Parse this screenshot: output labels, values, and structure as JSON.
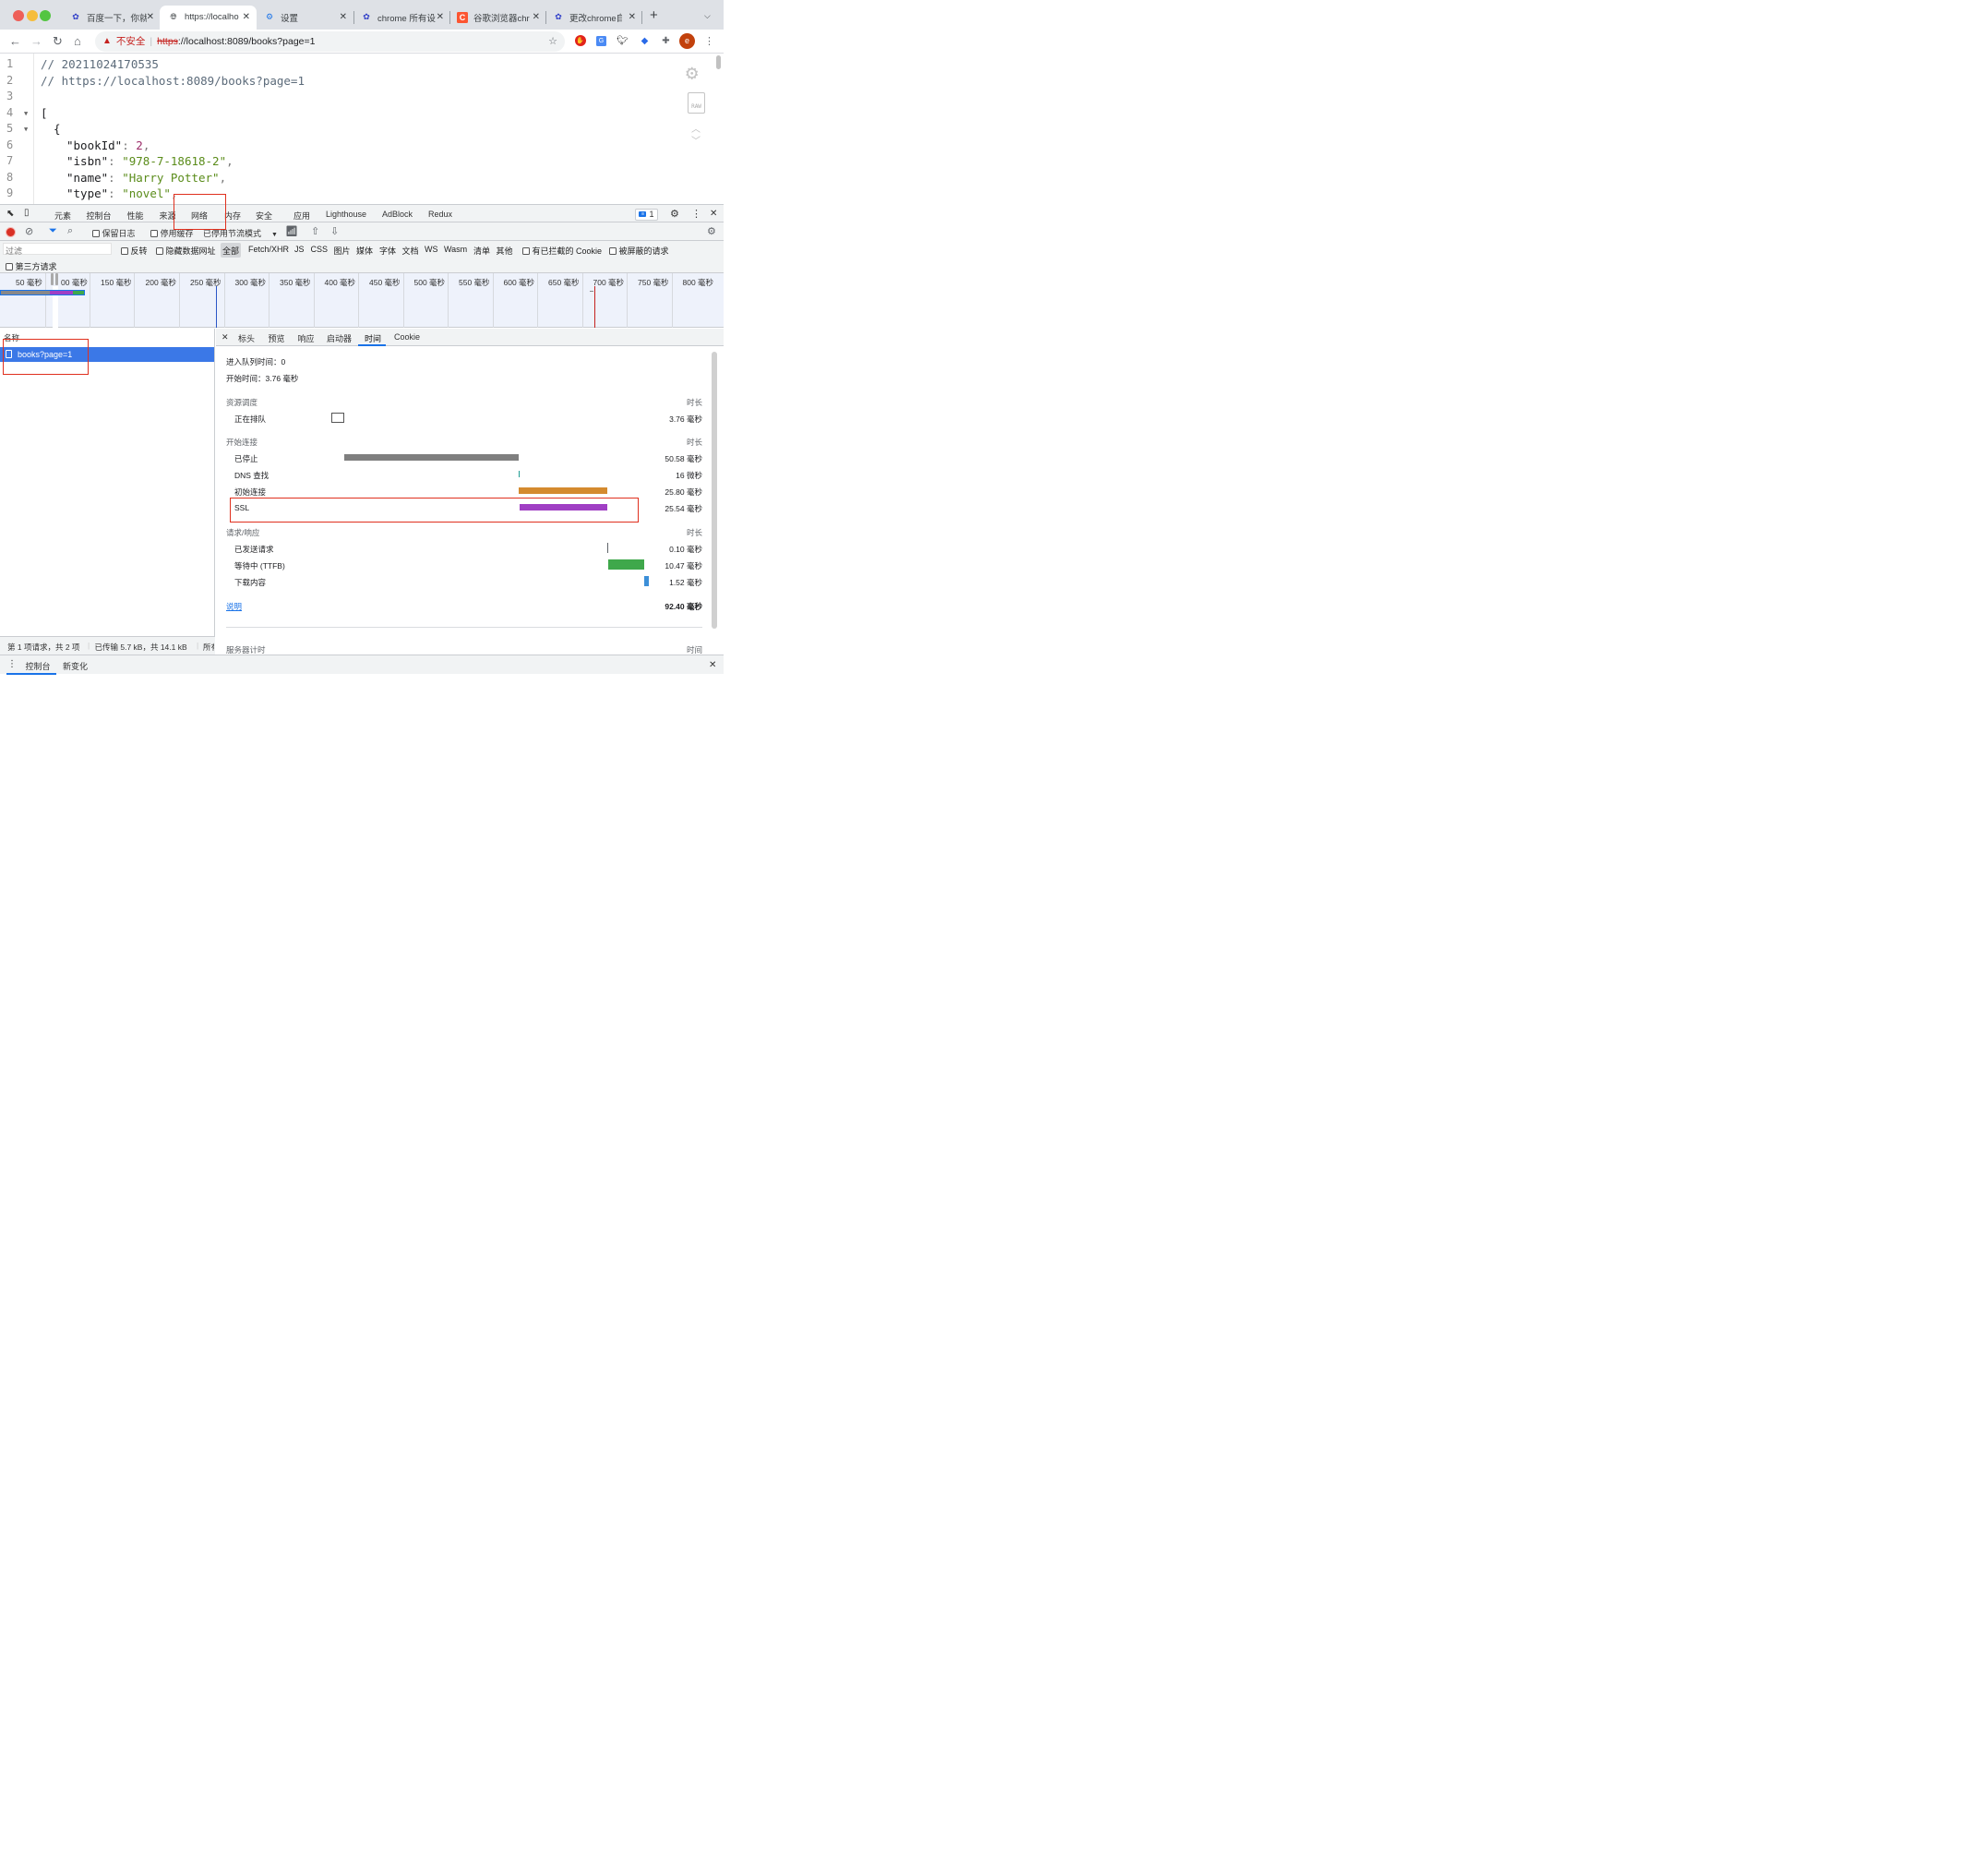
{
  "browser": {
    "tabs": [
      {
        "title": "百度一下，你就",
        "icon": "baidu-paw-icon"
      },
      {
        "title": "https://localho",
        "icon": "globe-icon"
      },
      {
        "title": "设置",
        "icon": "settings-gear-icon"
      },
      {
        "title": "chrome 所有设",
        "icon": "baidu-paw-icon"
      },
      {
        "title": "谷歌浏览器chr",
        "icon": "csdn-c-icon"
      },
      {
        "title": "更改chrome自",
        "icon": "baidu-paw-icon"
      }
    ],
    "new_tab": "+",
    "address": {
      "security_label": "不安全",
      "scheme": "https",
      "rest": "://localhost:8089/books?page=1"
    },
    "profile_letter": "e"
  },
  "code": {
    "lines": [
      {
        "n": "1",
        "text": "// 20211024170535"
      },
      {
        "n": "2",
        "text": "// https://localhost:8089/books?page=1"
      },
      {
        "n": "3",
        "text": ""
      },
      {
        "n": "4",
        "text": "["
      },
      {
        "n": "5",
        "text": "{"
      },
      {
        "n": "6",
        "key": "\"bookId\"",
        "val": "2"
      },
      {
        "n": "7",
        "key": "\"isbn\"",
        "val": "\"978-7-18618-2\""
      },
      {
        "n": "8",
        "key": "\"name\"",
        "val": "\"Harry Potter\""
      },
      {
        "n": "9",
        "key": "\"type\"",
        "val": "\"novel\""
      }
    ],
    "raw_label": "RAW"
  },
  "devtools": {
    "tabs": [
      "元素",
      "控制台",
      "性能",
      "来源",
      "网络",
      "内存",
      "安全",
      "应用",
      "Lighthouse",
      "AdBlock",
      "Redux"
    ],
    "active_tab": "网络",
    "issues_count": "1",
    "network_toolbar": {
      "preserve_log": "保留日志",
      "disable_cache": "停用缓存",
      "throttle": "已停用节流模式"
    },
    "filter": {
      "placeholder": "过滤",
      "invert": "反转",
      "hide_data_urls": "隐藏数据网址",
      "types": [
        "全部",
        "Fetch/XHR",
        "JS",
        "CSS",
        "图片",
        "媒体",
        "字体",
        "文档",
        "WS",
        "Wasm",
        "清单",
        "其他"
      ],
      "blocked_cookies": "有已拦截的 Cookie",
      "blocked_requests": "被屏蔽的请求",
      "third_party": "第三方请求"
    },
    "overview_ticks": [
      "50 毫秒",
      "00 毫秒",
      "150 毫秒",
      "200 毫秒",
      "250 毫秒",
      "300 毫秒",
      "350 毫秒",
      "400 毫秒",
      "450 毫秒",
      "500 毫秒",
      "550 毫秒",
      "600 毫秒",
      "650 毫秒",
      "700 毫秒",
      "750 毫秒",
      "800 毫秒"
    ],
    "name_header": "名称",
    "request": "books?page=1",
    "detail_tabs": [
      "标头",
      "预览",
      "响应",
      "启动器",
      "时间",
      "Cookie"
    ],
    "active_detail_tab": "时间",
    "timing": {
      "queued_at": "进入队列时间：0",
      "started_at": "开始时间：3.76 毫秒",
      "duration_header": "时长",
      "sections": [
        {
          "title": "资源调度",
          "rows": [
            {
              "label": "正在排队",
              "value": "3.76 毫秒",
              "start_ms": 0,
              "dur_ms": 3.76,
              "color": "#ffffff"
            }
          ]
        },
        {
          "title": "开始连接",
          "rows": [
            {
              "label": "已停止",
              "value": "50.58 毫秒",
              "start_ms": 3.76,
              "dur_ms": 50.58,
              "color": "#7f7f7f"
            },
            {
              "label": "DNS 查找",
              "value": "16 微秒",
              "start_ms": 54.34,
              "dur_ms": 0.016,
              "color": "#1f9c93"
            },
            {
              "label": "初始连接",
              "value": "25.80 毫秒",
              "start_ms": 54.36,
              "dur_ms": 25.8,
              "color": "#d48a2e"
            },
            {
              "label": "SSL",
              "value": "25.54 毫秒",
              "start_ms": 54.62,
              "dur_ms": 25.54,
              "color": "#a03fc4"
            }
          ]
        },
        {
          "title": "请求/响应",
          "rows": [
            {
              "label": "已发送请求",
              "value": "0.10 毫秒",
              "start_ms": 80.16,
              "dur_ms": 0.1,
              "color": "#5f6368"
            },
            {
              "label": "等待中 (TTFB)",
              "value": "10.47 毫秒",
              "start_ms": 80.26,
              "dur_ms": 10.47,
              "color": "#3fa84b"
            },
            {
              "label": "下载内容",
              "value": "1.52 毫秒",
              "start_ms": 90.73,
              "dur_ms": 1.52,
              "color": "#3c8fd8"
            }
          ]
        }
      ],
      "explain_link": "说明",
      "total": "92.40 毫秒",
      "server_timing": "服务器计时",
      "server_time_header": "时间"
    },
    "status": "第 1 项请求，共 2 项",
    "transferred": "已传输 5.7 kB，共 14.1 kB",
    "status_more": "所有",
    "drawer_tabs": [
      "控制台",
      "新变化"
    ]
  }
}
